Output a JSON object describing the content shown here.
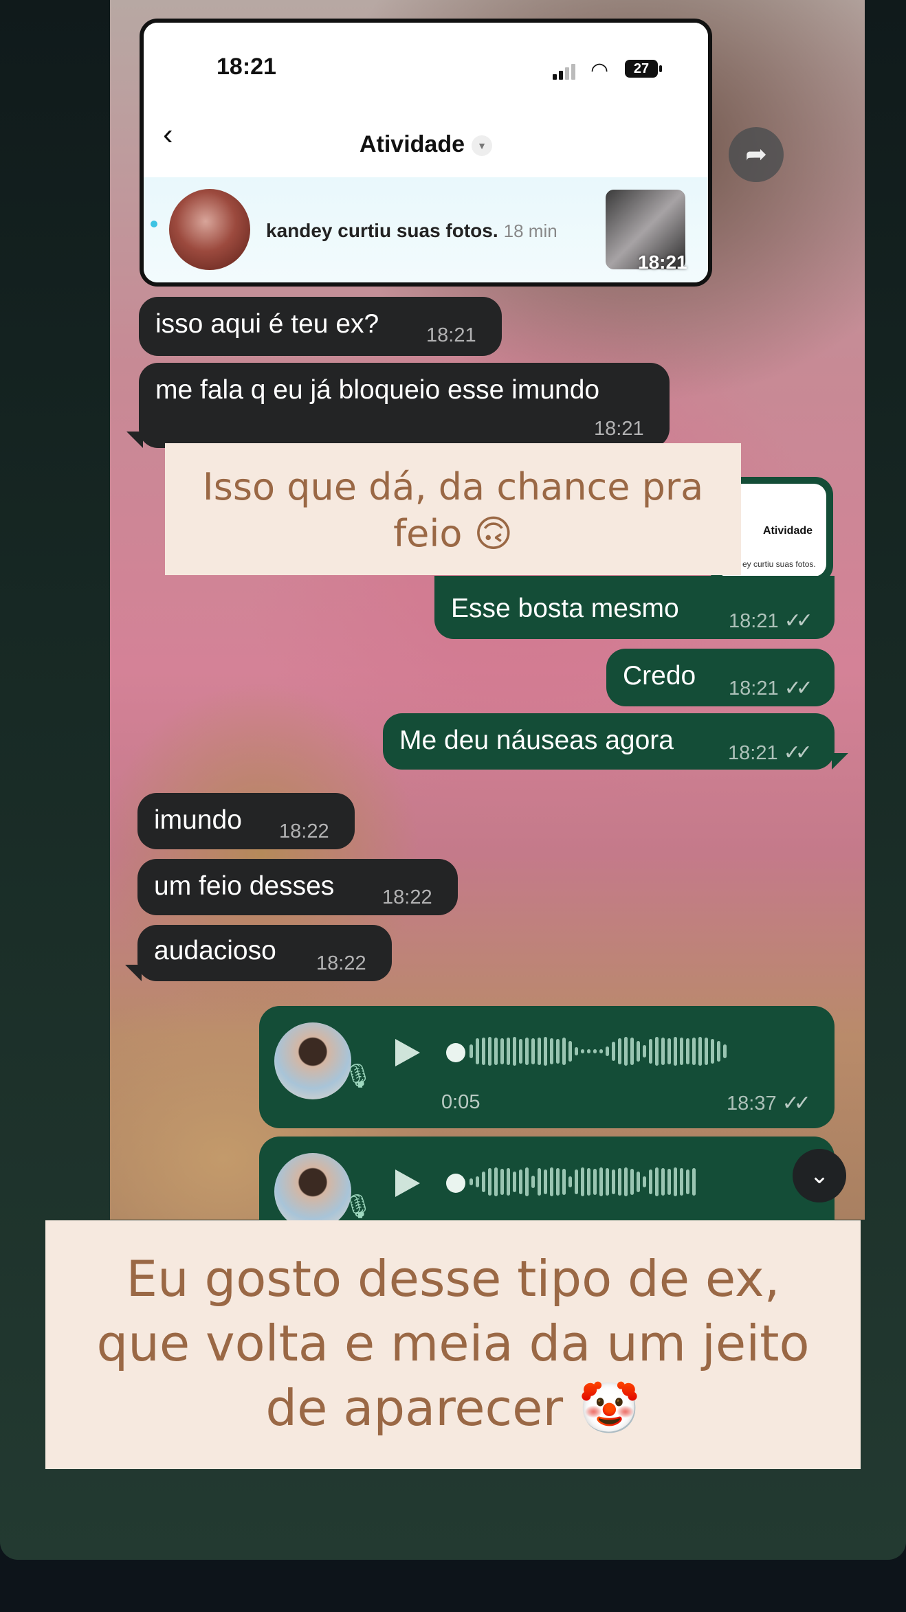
{
  "screenshot_card": {
    "status_time": "18:21",
    "battery": "27",
    "header_title": "Atividade",
    "notification_text": "kandey curtiu suas fotos.",
    "notification_ago": "18 min",
    "image_time": "18:21"
  },
  "messages": [
    {
      "dir": "in",
      "text": "isso aqui é teu ex?",
      "time": "18:21"
    },
    {
      "dir": "in",
      "text": "me fala q eu já bloqueio esse imundo",
      "time": "18:21"
    },
    {
      "dir": "out",
      "text": "Esse bosta mesmo",
      "time": "18:21"
    },
    {
      "dir": "out",
      "text": "Credo",
      "time": "18:21"
    },
    {
      "dir": "out",
      "text": "Me deu náuseas agora",
      "time": "18:21"
    },
    {
      "dir": "in",
      "text": "imundo",
      "time": "18:22"
    },
    {
      "dir": "in",
      "text": "um feio desses",
      "time": "18:22"
    },
    {
      "dir": "in",
      "text": "audacioso",
      "time": "18:22"
    }
  ],
  "quoted_mini": {
    "title": "Atividade",
    "text": "ey curtiu suas fotos."
  },
  "voice_notes": [
    {
      "duration": "0:05",
      "time": "18:37"
    }
  ],
  "ticks": "✓✓",
  "sticker_top": {
    "line1": "Isso que dá, da chance pra",
    "line2": "feio 🙃"
  },
  "sticker_bottom": {
    "line1": "Eu gosto desse tipo de ex,",
    "line2": "que volta e meia da um jeito",
    "line3": "de aparecer 🤡"
  },
  "colors": {
    "incoming_bubble": "#232425",
    "outgoing_bubble": "#144d37",
    "sticker_bg": "#f6e9df",
    "sticker_text": "#9a6845"
  }
}
